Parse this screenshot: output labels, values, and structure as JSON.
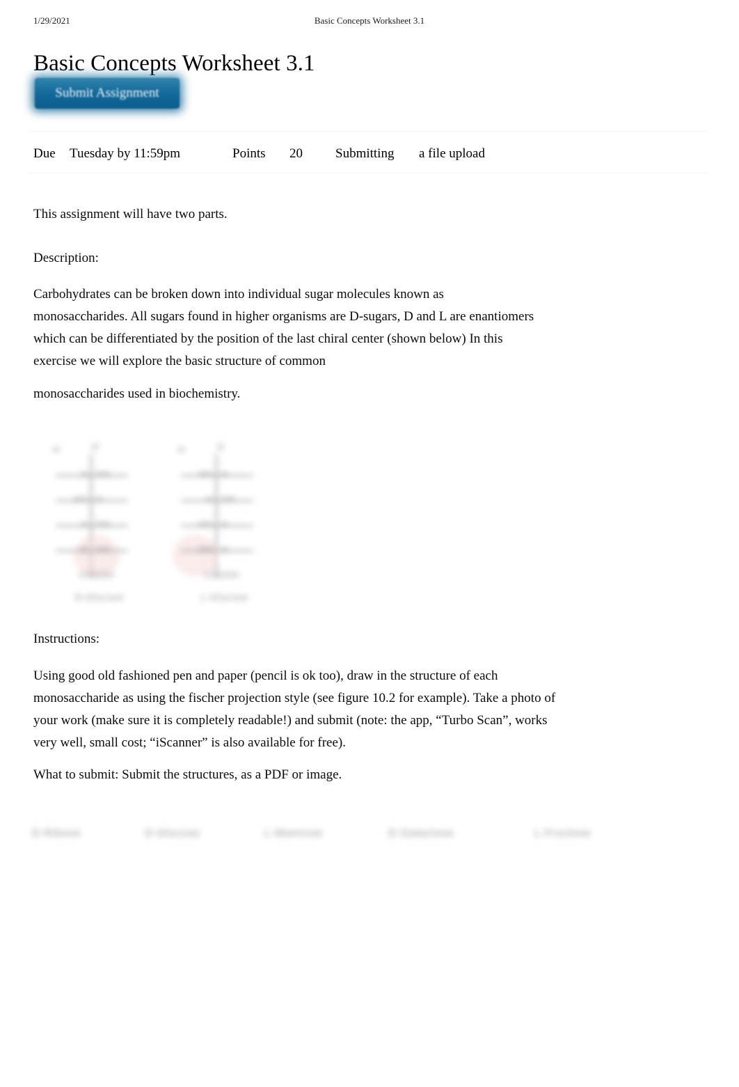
{
  "print_header": {
    "date": "1/29/2021",
    "doc_title": "Basic Concepts Worksheet 3.1"
  },
  "page_title": "Basic Concepts Worksheet 3.1",
  "submit_button": {
    "label": "Submit Assignment",
    "accent_color": "#13699a",
    "text_color": "#f2f7fa"
  },
  "assignment_meta": {
    "due_label": "Due",
    "due_value": "Tuesday by 11:59pm",
    "points_label": "Points",
    "points_value": "20",
    "submitting_label": "Submitting",
    "submitting_value": "a file upload"
  },
  "content": {
    "intro": "This assignment will have two parts.",
    "description_label": "Description:",
    "description_paragraph": "Carbohydrates can be broken down into individual sugar molecules known as monosaccharides. All sugars found in higher organisms are D-sugars, D and L are enantiomers which can be differentiated by the position of the last chiral center (shown below) In this exercise we will explore the basic structure of common",
    "description_paragraph_cont": "monosaccharides used in biochemistry.",
    "instructions_label": "Instructions:",
    "instructions_paragraph": "Using good old fashioned pen and paper (pencil is ok too), draw in the structure of each monosaccharide as using the fischer projection style (see figure 10.2 for example). Take a photo of your work (make sure it is completely readable!) and submit (note: the app, “Turbo Scan”, works very well, small cost; “iScanner” is also available for free).",
    "what_to_submit": "What to submit: Submit the structures, as a PDF or image."
  },
  "figure": {
    "note": "blurred fischer projection pair",
    "highlight_color": "#efc6c4",
    "structures": [
      {
        "caption": "D-Glucose",
        "top_left": "H",
        "top_right": "O",
        "rows": [
          {
            "left": "H",
            "right": "OH"
          },
          {
            "left": "HO",
            "right": "H"
          },
          {
            "left": "H",
            "right": "OH"
          },
          {
            "left": "H",
            "right": "OH"
          }
        ],
        "base": "CH2OH"
      },
      {
        "caption": "L-Glucose",
        "top_left": "H",
        "top_right": "O",
        "rows": [
          {
            "left": "HO",
            "right": "H"
          },
          {
            "left": "H",
            "right": "OH"
          },
          {
            "left": "HO",
            "right": "H"
          },
          {
            "left": "HO",
            "right": "H"
          }
        ],
        "base": "CH2OH"
      }
    ]
  },
  "sugar_labels": [
    "D-Ribose",
    "D-Glucose",
    "L-Mannose",
    "D-Galactose",
    "L-Fructose"
  ]
}
